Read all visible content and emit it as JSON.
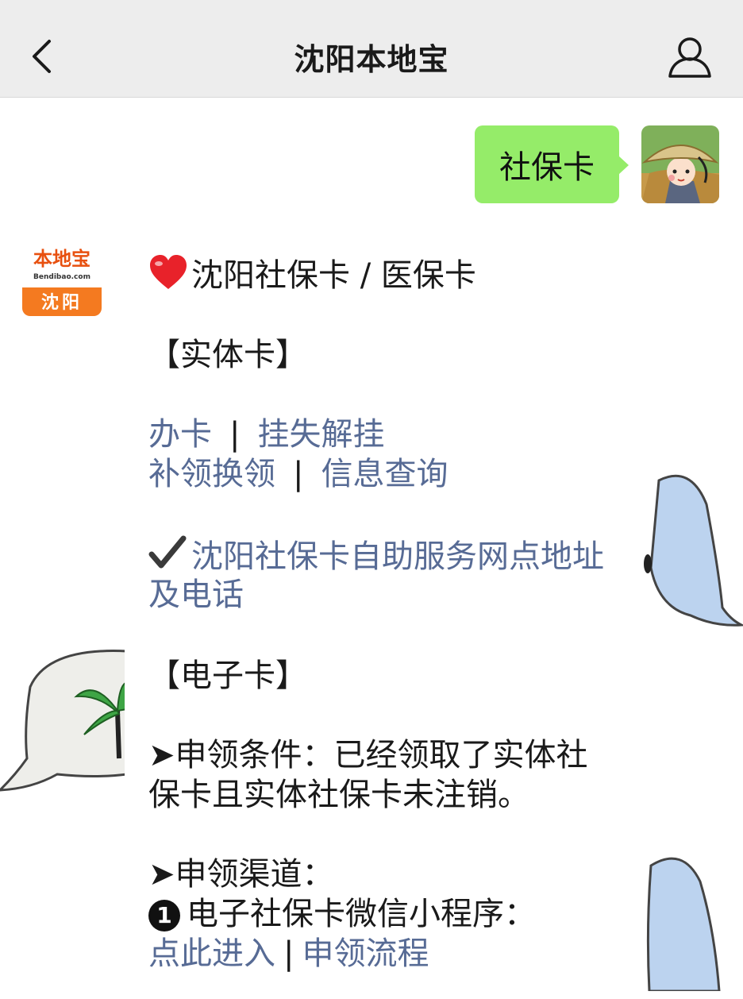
{
  "nav": {
    "title": "沈阳本地宝",
    "back_icon": "chevron-left-icon",
    "profile_icon": "person-icon"
  },
  "chat": {
    "sent_message": "社保卡",
    "bot_logo": {
      "brand": "本地宝",
      "domain": "Bendibao.com",
      "city": "沈阳"
    }
  },
  "reply": {
    "heading": "沈阳社保卡 / 医保卡",
    "section_physical": "【实体卡】",
    "link_apply": "办卡",
    "link_loss": "挂失解挂",
    "link_reissue": "补领换领",
    "link_query": "信息查询",
    "separator": "|",
    "link_selfservice_line1": "沈阳社保卡自助服务网点地址",
    "link_selfservice_line2": "及电话",
    "section_electronic": "【电子卡】",
    "condition_line1": "➤申领条件：已经领取了实体社",
    "condition_line2": "保卡且实体社保卡未注销。",
    "channel_title": "➤申领渠道：",
    "channel_number": "1",
    "channel_1": "电子社保卡微信小程序：",
    "link_enter": "点此进入",
    "link_process": "申领流程",
    "pipe": "|"
  },
  "colors": {
    "nav_bg": "#ededed",
    "sent_bubble": "#95ec69",
    "link": "#576b95",
    "logo_orange": "#f47a20"
  }
}
